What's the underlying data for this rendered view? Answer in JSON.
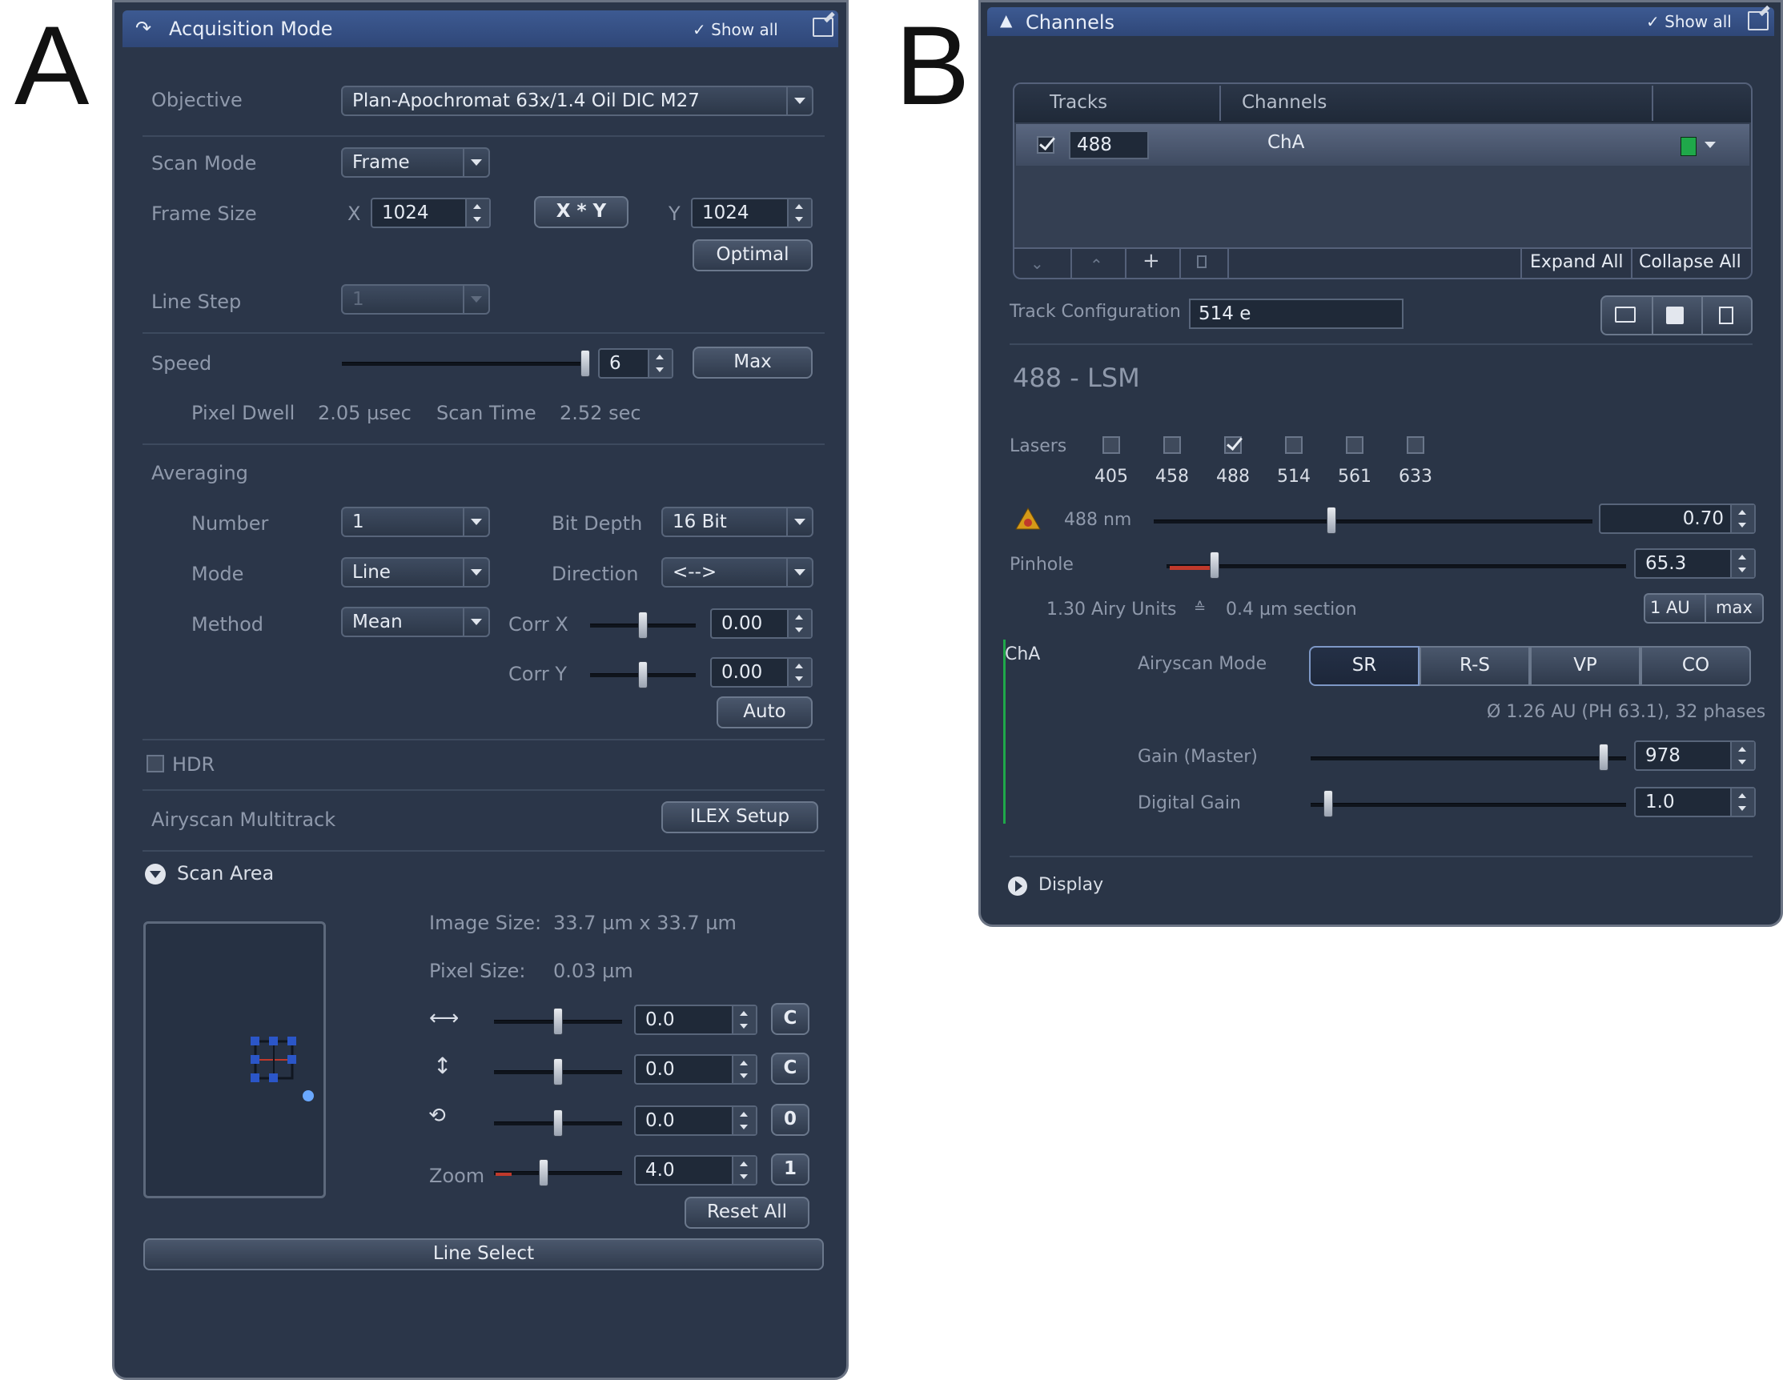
{
  "figure": {
    "label_a": "A",
    "label_b": "B"
  },
  "acq": {
    "title": "Acquisition Mode",
    "show_all": "Show all",
    "objective_label": "Objective",
    "objective_value": "Plan-Apochromat 63x/1.4 Oil DIC M27",
    "scan_mode_label": "Scan Mode",
    "scan_mode_value": "Frame",
    "frame_size_label": "Frame Size",
    "x_label": "X",
    "x_value": "1024",
    "xy_button": "X * Y",
    "y_label": "Y",
    "y_value": "1024",
    "optimal_button": "Optimal",
    "line_step_label": "Line Step",
    "line_step_value": "1",
    "speed_label": "Speed",
    "speed_value": "6",
    "max_button": "Max",
    "pixel_dwell_label": "Pixel Dwell",
    "pixel_dwell_value": "2.05 µsec",
    "scan_time_label": "Scan Time",
    "scan_time_value": "2.52 sec",
    "averaging_label": "Averaging",
    "number_label": "Number",
    "number_value": "1",
    "bit_depth_label": "Bit Depth",
    "bit_depth_value": "16 Bit",
    "mode_label": "Mode",
    "mode_value": "Line",
    "direction_label": "Direction",
    "direction_value": "<-->",
    "method_label": "Method",
    "method_value": "Mean",
    "corr_x_label": "Corr X",
    "corr_x_value": "0.00",
    "corr_y_label": "Corr Y",
    "corr_y_value": "0.00",
    "auto_button": "Auto",
    "hdr_label": "HDR",
    "airyscan_multitrack_label": "Airyscan Multitrack",
    "ilex_button": "ILEX Setup",
    "scan_area_label": "Scan Area",
    "image_size_label": "Image Size:",
    "image_size_value": "33.7  µm x 33.7  µm",
    "pixel_size_label": "Pixel Size:",
    "pixel_size_value": "0.03 µm",
    "offset_x_value": "0.0",
    "offset_x_btn": "C",
    "offset_y_value": "0.0",
    "offset_y_btn": "C",
    "rotation_value": "0.0",
    "rotation_btn": "0",
    "zoom_label": "Zoom",
    "zoom_value": "4.0",
    "zoom_btn": "1",
    "reset_all_button": "Reset All",
    "line_select_button": "Line Select"
  },
  "chan": {
    "title": "Channels",
    "show_all": "Show all",
    "col_tracks": "Tracks",
    "col_channels": "Channels",
    "track_value": "488",
    "channel_value": "ChA",
    "channel_color": "#1fa84a",
    "add_symbol": "+",
    "expand_all": "Expand All",
    "collapse_all": "Collapse All",
    "track_config_label": "Track Configuration",
    "track_config_value": "514 e",
    "section_title": "488 - LSM",
    "lasers_label": "Lasers",
    "lasers": [
      {
        "wl": "405",
        "checked": false
      },
      {
        "wl": "458",
        "checked": false
      },
      {
        "wl": "488",
        "checked": true
      },
      {
        "wl": "514",
        "checked": false
      },
      {
        "wl": "561",
        "checked": false
      },
      {
        "wl": "633",
        "checked": false
      }
    ],
    "laser_line_label": "488 nm",
    "laser_power_value": "0.70",
    "pinhole_label": "Pinhole",
    "pinhole_value": "65.3",
    "airy_units_value": "1.30 Airy Units",
    "section_value": "0.4 µm section",
    "one_au_button": "1 AU",
    "max_button": "max",
    "channel_name": "ChA",
    "airyscan_mode_label": "Airyscan Mode",
    "modes": [
      "SR",
      "R-S",
      "VP",
      "CO"
    ],
    "active_mode": "SR",
    "airyscan_info": "Ø 1.26 AU (PH 63.1), 32 phases",
    "gain_label": "Gain (Master)",
    "gain_value": "978",
    "digital_gain_label": "Digital Gain",
    "digital_gain_value": "1.0",
    "display_label": "Display"
  },
  "icons": [
    "collapse-arrow-icon",
    "checkmark-icon",
    "edit-icon",
    "warning-icon",
    "open-folder-icon",
    "save-icon",
    "trash-icon",
    "expand-circle-icon",
    "horizontal-arrow-icon",
    "vertical-arrow-icon",
    "rotate-icon"
  ]
}
